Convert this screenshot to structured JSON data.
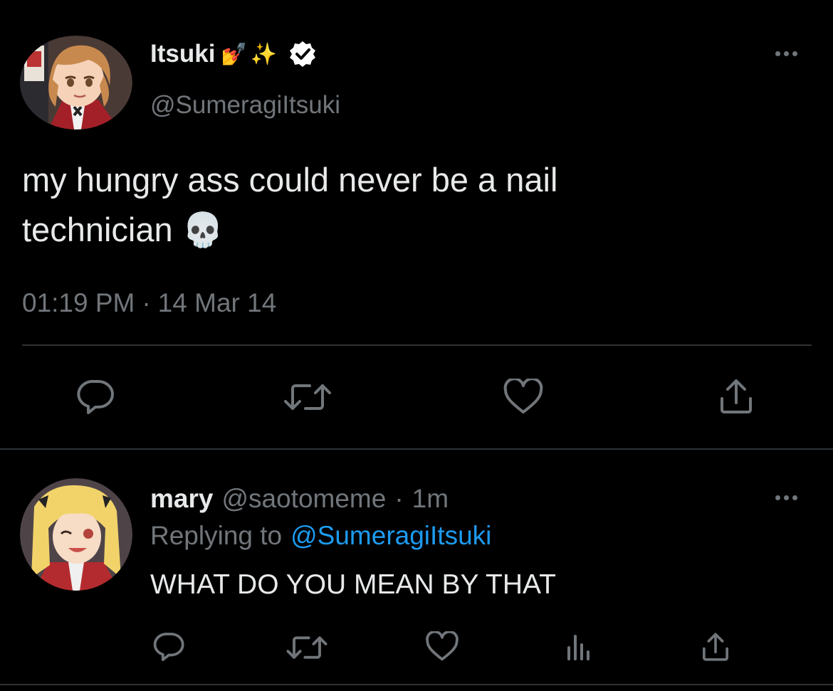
{
  "tweet": {
    "author_name": "Itsuki",
    "author_emoji": "💅✨",
    "author_handle": "@SumeragiItsuki",
    "text_line1": "my hungry ass could never be a nail",
    "text_line2": "technician 💀",
    "time": "01:19 PM",
    "separator": "·",
    "date": "14 Mar 14"
  },
  "reply": {
    "author_name": "mary",
    "author_handle": "@saotomeme",
    "separator": "·",
    "age": "1m",
    "replying_prefix": "Replying to",
    "replying_handle": "@SumeragiItsuki",
    "text": "WHAT DO YOU MEAN BY THAT"
  },
  "icons": {
    "verified": "verified-badge-icon",
    "reply": "reply-bubble-icon",
    "retweet": "retweet-icon",
    "like": "heart-icon",
    "share": "share-upload-icon",
    "views": "analytics-bars-icon",
    "more": "more-dots-icon"
  },
  "colors": {
    "background": "#000000",
    "text": "#e7e9ea",
    "muted": "#71767b",
    "link": "#1d9bf0",
    "divider": "#2f3336"
  }
}
